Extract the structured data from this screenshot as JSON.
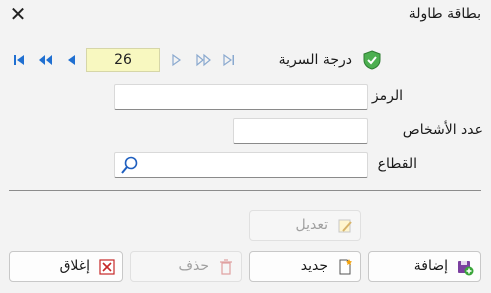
{
  "window": {
    "title": "بطاقة طاولة",
    "close_icon": "close-icon"
  },
  "nav": {
    "page": "26",
    "first_icon": "first-icon",
    "prev_fast_icon": "rewind-icon",
    "prev_icon": "previous-icon",
    "next_icon": "next-icon",
    "next_fast_icon": "fast-forward-icon",
    "last_icon": "last-icon"
  },
  "form": {
    "secrecy_label": "درجة السرية",
    "code_label": "الرمز",
    "code_value": "",
    "persons_label": "عدد الأشخاص",
    "persons_value": "",
    "sector_label": "القطاع",
    "sector_value": ""
  },
  "buttons": {
    "edit": "تعديل",
    "add": "إضافة",
    "new": "جديد",
    "delete": "حذف",
    "close": "إغلاق"
  },
  "colors": {
    "nav_blue": "#1f6fd1",
    "page_bg": "#f8f8c0",
    "shield_green": "#2e9e44"
  }
}
